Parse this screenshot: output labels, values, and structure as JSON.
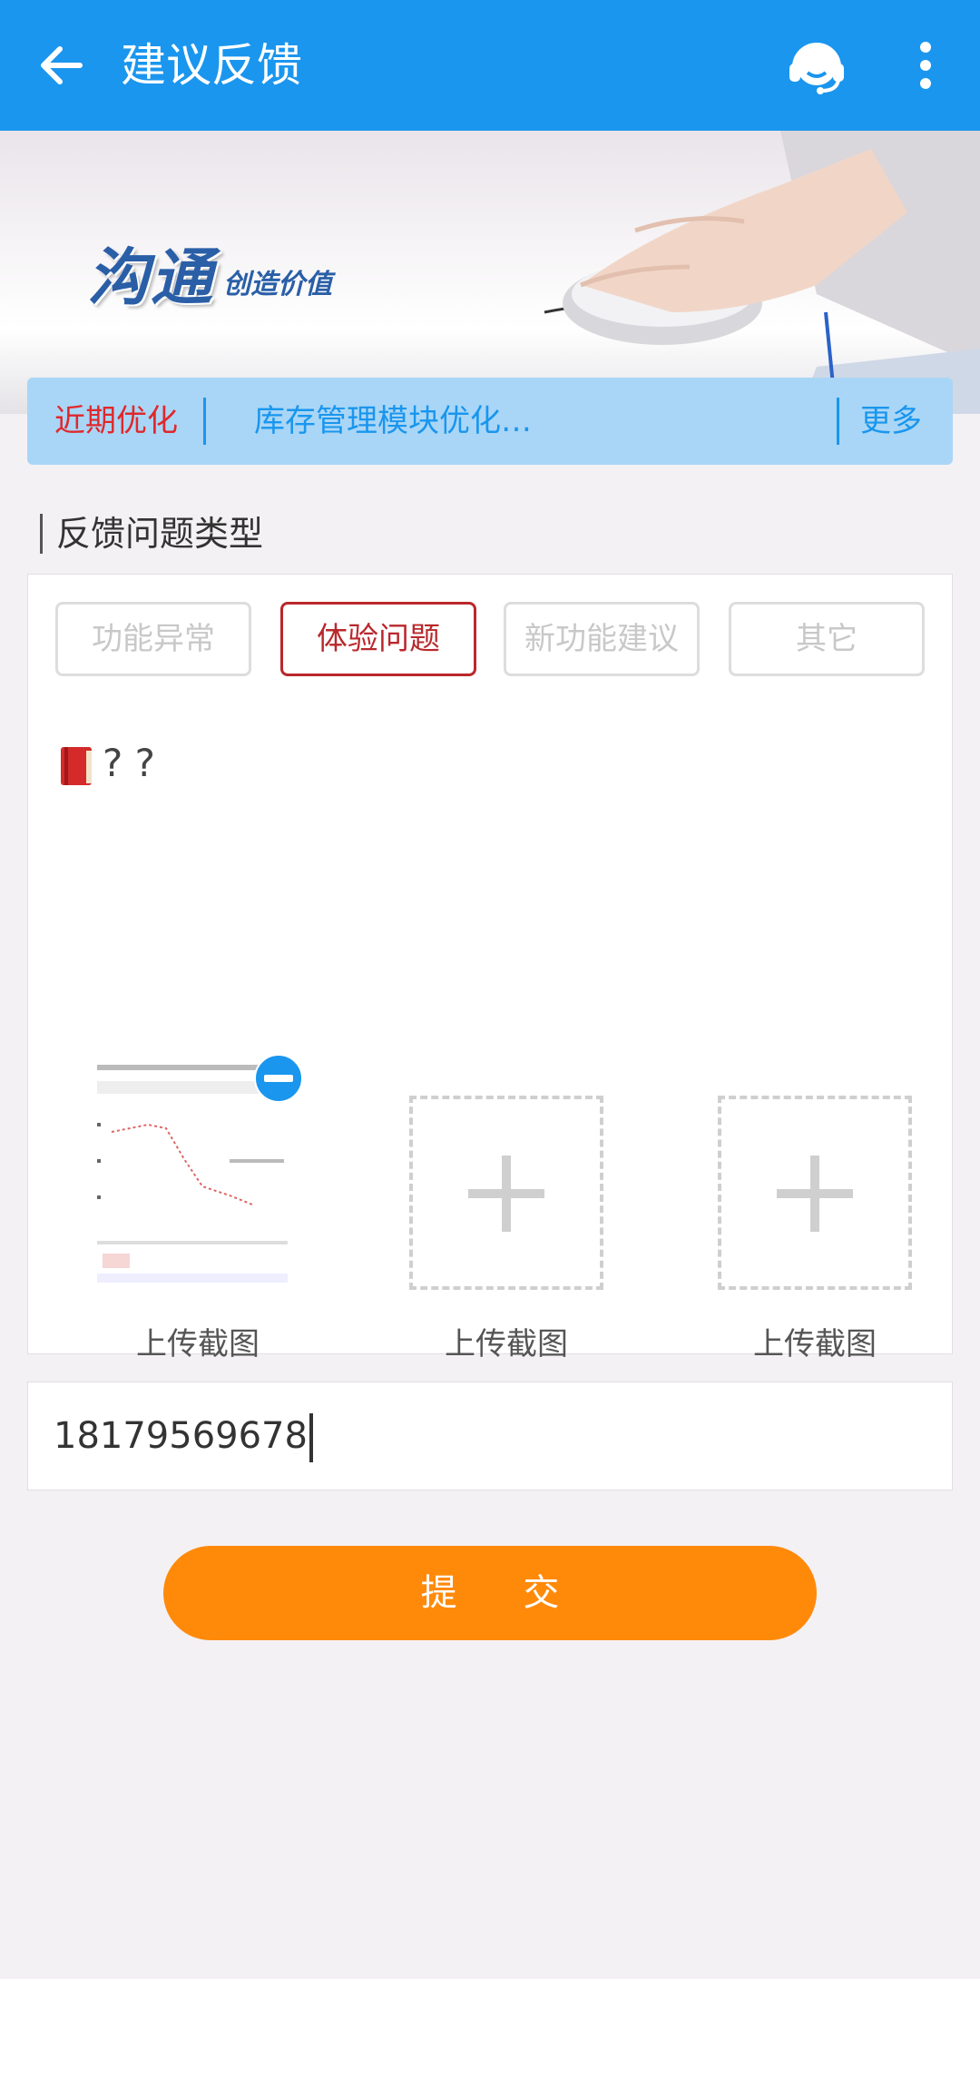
{
  "header": {
    "title": "建议反馈",
    "background": "#1a96ee"
  },
  "banner": {
    "slogan_main": "沟通",
    "slogan_sub": "创造价值"
  },
  "notice": {
    "label": "近期优化",
    "text": "库存管理模块优化…",
    "more": "更多"
  },
  "feedback": {
    "section_title": "反馈问题类型",
    "types": [
      {
        "label": "功能异常",
        "selected": false
      },
      {
        "label": "体验问题",
        "selected": true
      },
      {
        "label": "新功能建议",
        "selected": false
      },
      {
        "label": "其它",
        "selected": false
      }
    ],
    "description": "? ?",
    "uploads": [
      {
        "label": "上传截图",
        "has_image": true
      },
      {
        "label": "上传截图",
        "has_image": false
      },
      {
        "label": "上传截图",
        "has_image": false
      }
    ]
  },
  "contact": {
    "phone": "18179569678"
  },
  "submit": {
    "label": "提 交",
    "color": "#ff8a0a"
  }
}
